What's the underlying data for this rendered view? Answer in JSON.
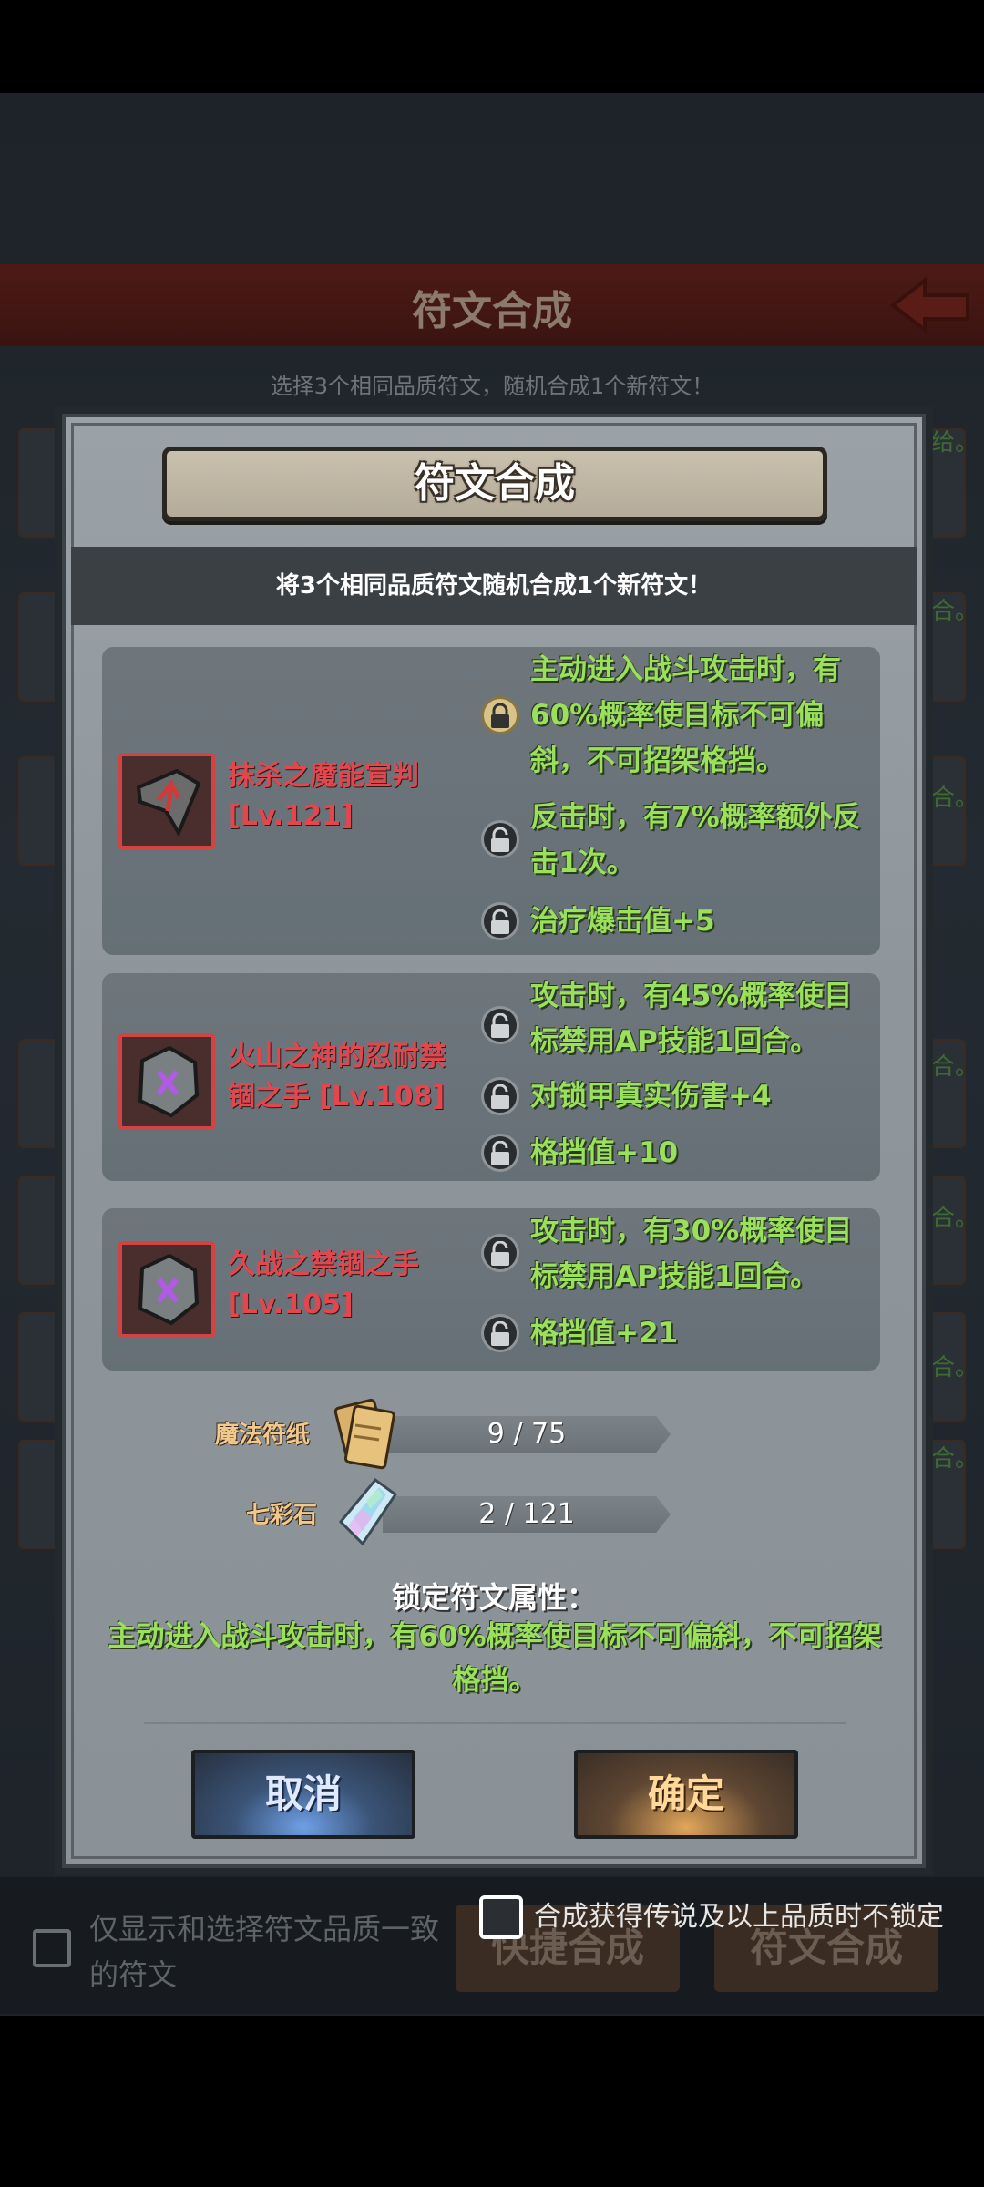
{
  "background": {
    "title": "符文合成",
    "subtitle": "选择3个相同品质符文，随机合成1个新符文！",
    "side_texts": [
      "给。",
      "合。",
      "合。",
      "合。",
      "合。",
      "合。",
      "合。"
    ],
    "only_same_quality_label": "仅显示和选择符文品质一致的符文",
    "quick_compose_label": "快捷合成",
    "compose_label": "符文合成"
  },
  "dialog": {
    "title": "符文合成",
    "description": "将3个相同品质符文随机合成1个新符文！",
    "runes": [
      {
        "name": "抹杀之魔能宣判",
        "level": "[Lv.121]",
        "attributes": [
          {
            "text": "主动进入战斗攻击时，有60%概率使目标不可偏斜，不可招架格挡。",
            "locked": true
          },
          {
            "text": "反击时，有7%概率额外反击1次。",
            "locked": false
          },
          {
            "text": "治疗爆击值+5",
            "locked": false
          }
        ]
      },
      {
        "name": "火山之神的忍耐禁锢之手",
        "level": "[Lv.108]",
        "attributes": [
          {
            "text": "攻击时，有45%概率使目标禁用AP技能1回合。",
            "locked": false
          },
          {
            "text": "对锁甲真实伤害+4",
            "locked": false
          },
          {
            "text": "格挡值+10",
            "locked": false
          }
        ]
      },
      {
        "name": "久战之禁锢之手",
        "level": "[Lv.105]",
        "attributes": [
          {
            "text": "攻击时，有30%概率使目标禁用AP技能1回合。",
            "locked": false
          },
          {
            "text": "格挡值+21",
            "locked": false
          }
        ]
      }
    ],
    "materials": [
      {
        "label": "魔法符纸",
        "count": "9 / 75",
        "icon": "scroll-paper-icon"
      },
      {
        "label": "七彩石",
        "count": "2 / 121",
        "icon": "rainbow-crystal-icon"
      }
    ],
    "lock_title": "锁定符文属性：",
    "lock_description": "主动进入战斗攻击时，有60%概率使目标不可偏斜，不可招架格挡。",
    "cancel_label": "取消",
    "confirm_label": "确定",
    "legend_option_label": "合成获得传说及以上品质时不锁定"
  },
  "colors": {
    "rune_name": "#e3464d",
    "attribute_text": "#9ae05d",
    "material_label": "#f1c98f",
    "cancel_glow": "#6f9fe6",
    "confirm_glow": "#e2a65b"
  }
}
